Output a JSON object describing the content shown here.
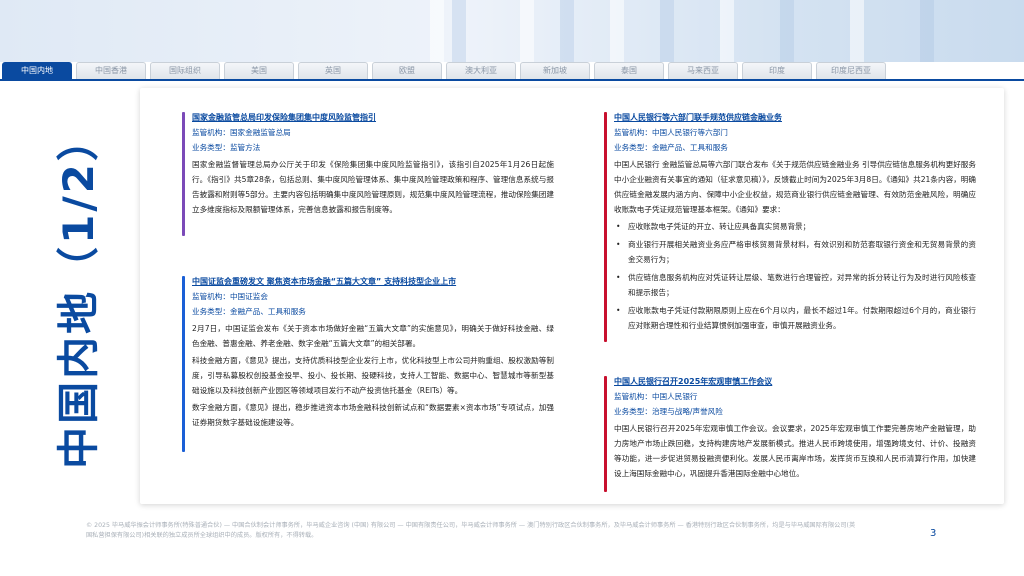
{
  "tabs": [
    {
      "label": "中国内地",
      "active": true
    },
    {
      "label": "中国香港"
    },
    {
      "label": "国际组织"
    },
    {
      "label": "美国"
    },
    {
      "label": "英国"
    },
    {
      "label": "欧盟"
    },
    {
      "label": "澳大利亚"
    },
    {
      "label": "新加坡"
    },
    {
      "label": "泰国"
    },
    {
      "label": "马来西亚"
    },
    {
      "label": "印度"
    },
    {
      "label": "印度尼西亚"
    }
  ],
  "side_title": "中国内地（1/2）",
  "sections": {
    "insurance": {
      "title": "国家金融监管总局印发保险集团集中度风险监管指引",
      "regulator": "监管机构：国家金融监管总局",
      "type": "业务类型：监管方法",
      "body": "国家金融监督管理总局办公厅关于印发《保险集团集中度风险监管指引》，该指引自2025年1月26日起施行。《指引》共5章28条，包括总则、集中度风险管理体系、集中度风险管理政策和程序、管理信息系统与报告披露和附则等5部分。主要内容包括明确集中度风险管理原则，规范集中度风险管理流程，推动保险集团建立多维度指标及限额管理体系，完善信息披露和报告制度等。"
    },
    "csrc": {
      "title": "中国证监会重磅发文 聚焦资本市场金融“五篇大文章” 支持科技型企业上市",
      "regulator": "监管机构：中国证监会",
      "type": "业务类型：金融产品、工具和服务",
      "paragraphs": [
        "2月7日，中国证监会发布《关于资本市场做好金融“五篇大文章”的实施意见》，明确关于做好科技金融、绿色金融、普惠金融、养老金融、数字金融“五篇大文章”的相关部署。",
        "科技金融方面，《意见》提出，支持优质科技型企业发行上市，优化科技型上市公司并购重组、股权激励等制度，引导私募股权创投基金投早、投小、投长期、投硬科技，支持人工智能、数据中心、智慧城市等新型基础设施以及科技创新产业园区等领域项目发行不动产投资信托基金（REITs）等。",
        "数字金融方面，《意见》提出，稳步推进资本市场金融科技创新试点和“数据要素×资本市场”专项试点，加强证券期货数字基础设施建设等。"
      ]
    },
    "supplychain": {
      "title": "中国人民银行等六部门联手规范供应链金融业务",
      "regulator": "监管机构：中国人民银行等六部门",
      "type": "业务类型：金融产品、工具和服务",
      "intro": "中国人民银行 金融监管总局等六部门联合发布《关于规范供应链金融业务 引导供应链信息服务机构更好服务中小企业融资有关事宜的通知（征求意见稿）》，反馈截止时间为2025年3月8日。《通知》共21条内容，明确供应链金融发展内涵方向、保障中小企业权益，规范商业银行供应链金融管理、有效防范金融风险，明确应收账款电子凭证规范管理基本框架。《通知》要求：",
      "bullets": [
        "应收账款电子凭证的开立、转让应具备真实贸易背景；",
        "商业银行开展相关融资业务应严格审核贸易背景材料，有效识别和防范套取银行资金和无贸易背景的资金交易行为；",
        "供应链信息服务机构应对凭证转让层级、笔数进行合理管控，对异常的拆分转让行为及时进行风险核查和提示报告；",
        "应收账款电子凭证付款期限原则上应在6个月以内，最长不超过1年。付款期限超过6个月的，商业银行应对账期合理性和行业结算惯例加强审查，审慎开展融资业务。"
      ]
    },
    "pboc": {
      "title": "中国人民银行召开2025年宏观审慎工作会议",
      "regulator": "监管机构：中国人民银行",
      "type": "业务类型：治理与战略/声誉风险",
      "body": "中国人民银行召开2025年宏观审慎工作会议。会议要求，2025年宏观审慎工作要完善房地产金融管理，助力房地产市场止跌回稳，支持构建房地产发展新模式。推进人民币跨境使用，增强跨境支付、计价、投融资等功能，进一步促进贸易投融资便利化。发展人民币离岸市场，发挥货币互换和人民币清算行作用，加快建设上海国际金融中心，巩固提升香港国际金融中心地位。"
    }
  },
  "footer": "© 2025 毕马威华振会计师事务所(特殊普通合伙) — 中国合伙制会计师事务所，毕马威企业咨询 (中国) 有限公司 — 中国有限责任公司，毕马威会计师事务所 — 澳门特别行政区合伙制事务所，及毕马威会计师事务所 — 香港特别行政区合伙制事务所，均是与毕马威国际有限公司(英国私营担保有限公司)相关联的独立成员所全球组织中的成员。版权所有，不得转载。",
  "page_number": "3",
  "colors": {
    "accent": "#0a4aa0",
    "bar_purple": "#7b4ab8",
    "bar_blue": "#1a5fd6",
    "bar_red": "#c8102e"
  }
}
